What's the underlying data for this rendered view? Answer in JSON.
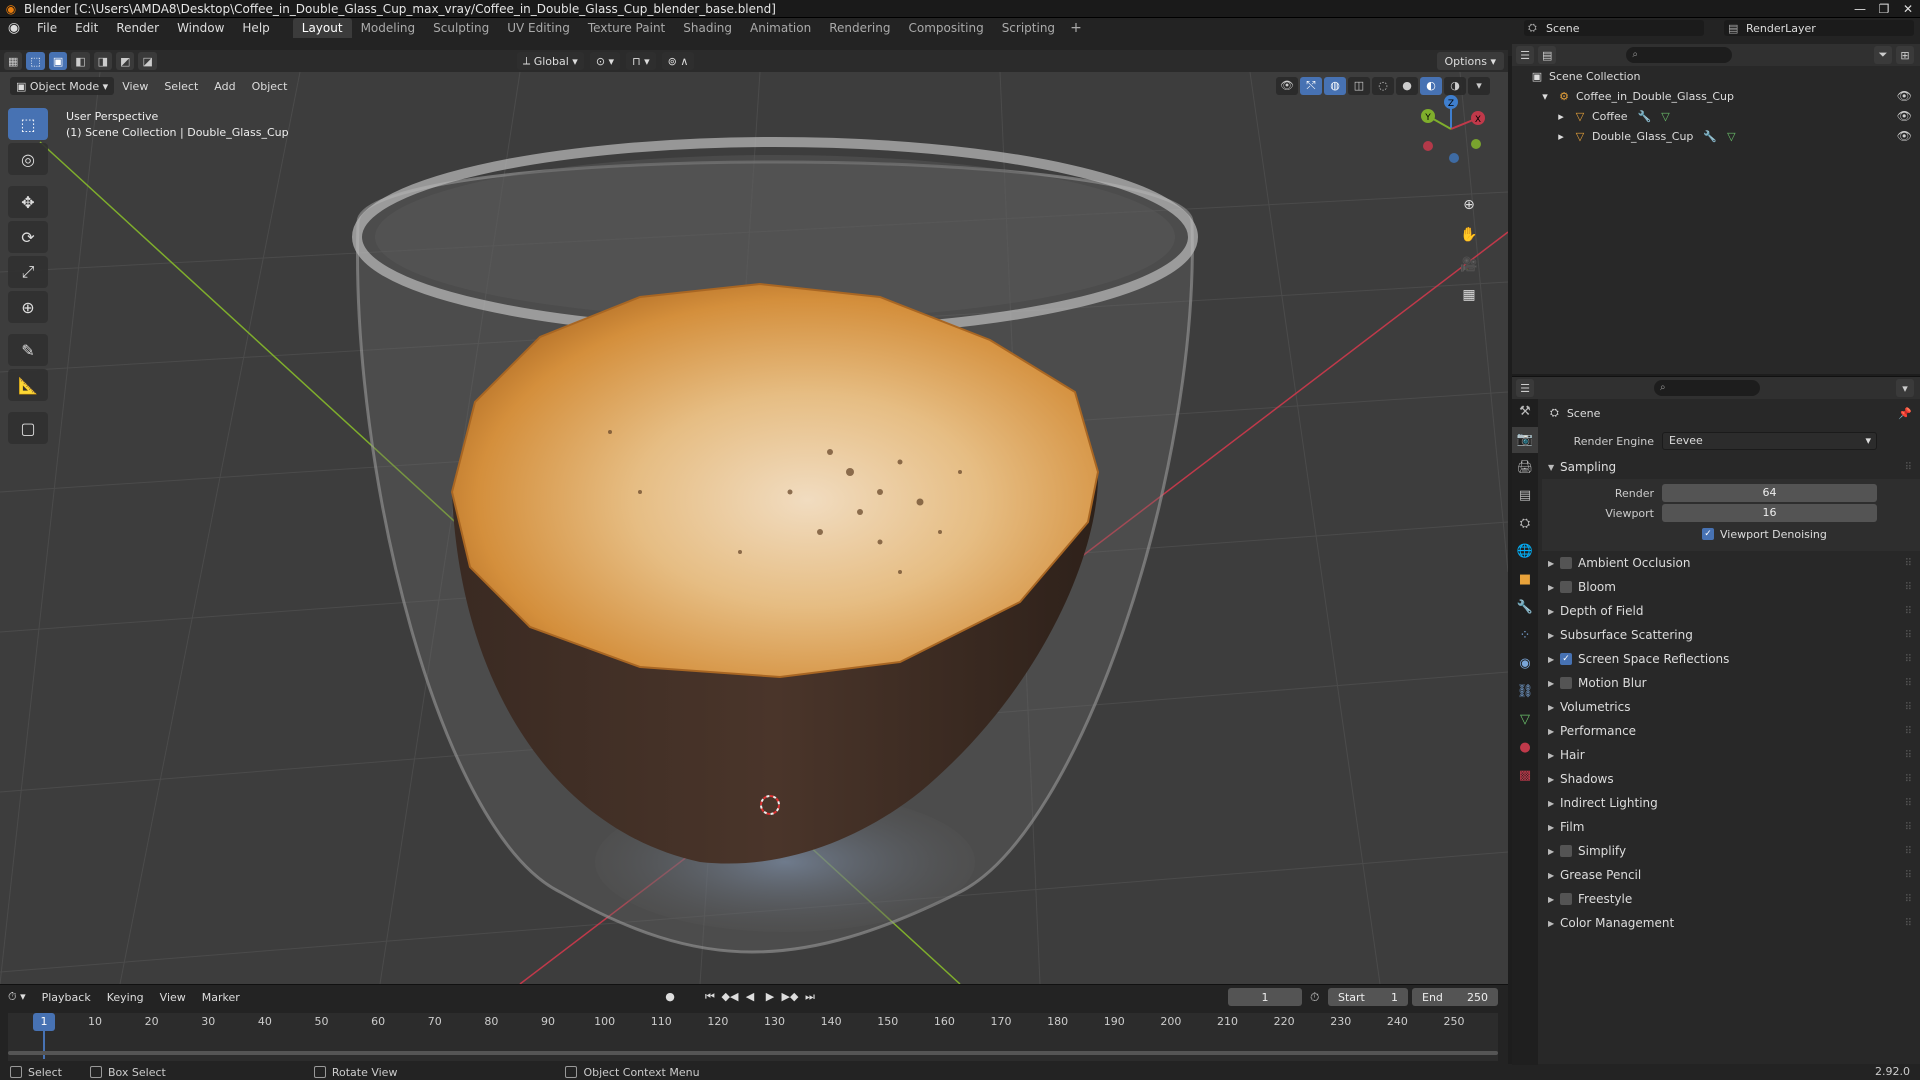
{
  "window": {
    "title": "Blender [C:\\Users\\AMDA8\\Desktop\\Coffee_in_Double_Glass_Cup_max_vray/Coffee_in_Double_Glass_Cup_blender_base.blend]",
    "controls": [
      "—",
      "❐",
      "✕"
    ]
  },
  "menubar": {
    "items": [
      "File",
      "Edit",
      "Render",
      "Window",
      "Help"
    ],
    "workspaces": [
      "Layout",
      "Modeling",
      "Sculpting",
      "UV Editing",
      "Texture Paint",
      "Shading",
      "Animation",
      "Rendering",
      "Compositing",
      "Scripting"
    ],
    "active_workspace": "Layout",
    "add_workspace": "+",
    "scene": "Scene",
    "view_layer": "RenderLayer"
  },
  "tool_header": {
    "orientation": "Global",
    "options": "Options"
  },
  "viewport_header": {
    "mode": "Object Mode",
    "menus": [
      "View",
      "Select",
      "Add",
      "Object"
    ]
  },
  "viewport": {
    "perspective": "User Perspective",
    "collection_info": "(1) Scene Collection | Double_Glass_Cup",
    "gizmo": {
      "x": "X",
      "y": "Y",
      "z": "Z"
    }
  },
  "timeline": {
    "menus": [
      "Playback",
      "Keying",
      "View",
      "Marker"
    ],
    "current_frame": "1",
    "start_label": "Start",
    "start": "1",
    "end_label": "End",
    "end": "250",
    "ticks": [
      "10",
      "20",
      "30",
      "40",
      "50",
      "60",
      "70",
      "80",
      "90",
      "100",
      "110",
      "120",
      "130",
      "140",
      "150",
      "160",
      "170",
      "180",
      "190",
      "200",
      "210",
      "220",
      "230",
      "240",
      "250"
    ],
    "playhead": "1"
  },
  "statusbar": {
    "select": "Select",
    "box_select": "Box Select",
    "rotate_view": "Rotate View",
    "context_menu": "Object Context Menu",
    "version": "2.92.0"
  },
  "outliner": {
    "root": "Scene Collection",
    "collection": "Coffee_in_Double_Glass_Cup",
    "objects": [
      "Coffee",
      "Double_Glass_Cup"
    ]
  },
  "properties": {
    "context": "Scene",
    "render_engine_label": "Render Engine",
    "render_engine": "Eevee",
    "sampling": {
      "title": "Sampling",
      "render_label": "Render",
      "render": "64",
      "viewport_label": "Viewport",
      "viewport": "16",
      "denoising_label": "Viewport Denoising"
    },
    "panels": [
      {
        "label": "Ambient Occlusion",
        "checkbox": true,
        "checked": false
      },
      {
        "label": "Bloom",
        "checkbox": true,
        "checked": false
      },
      {
        "label": "Depth of Field",
        "checkbox": false,
        "checked": false
      },
      {
        "label": "Subsurface Scattering",
        "checkbox": false,
        "checked": false
      },
      {
        "label": "Screen Space Reflections",
        "checkbox": true,
        "checked": true
      },
      {
        "label": "Motion Blur",
        "checkbox": true,
        "checked": false
      },
      {
        "label": "Volumetrics",
        "checkbox": false,
        "checked": false
      },
      {
        "label": "Performance",
        "checkbox": false,
        "checked": false
      },
      {
        "label": "Hair",
        "checkbox": false,
        "checked": false
      },
      {
        "label": "Shadows",
        "checkbox": false,
        "checked": false
      },
      {
        "label": "Indirect Lighting",
        "checkbox": false,
        "checked": false
      },
      {
        "label": "Film",
        "checkbox": false,
        "checked": false
      },
      {
        "label": "Simplify",
        "checkbox": true,
        "checked": false
      },
      {
        "label": "Grease Pencil",
        "checkbox": false,
        "checked": false
      },
      {
        "label": "Freestyle",
        "checkbox": true,
        "checked": false
      },
      {
        "label": "Color Management",
        "checkbox": false,
        "checked": false
      }
    ]
  },
  "colors": {
    "accent": "#4772b3",
    "viewport_bg": "#3d3d3d",
    "x_axis": "#c0394a",
    "y_axis": "#7fae2c",
    "z_axis": "#3f7fcf"
  }
}
